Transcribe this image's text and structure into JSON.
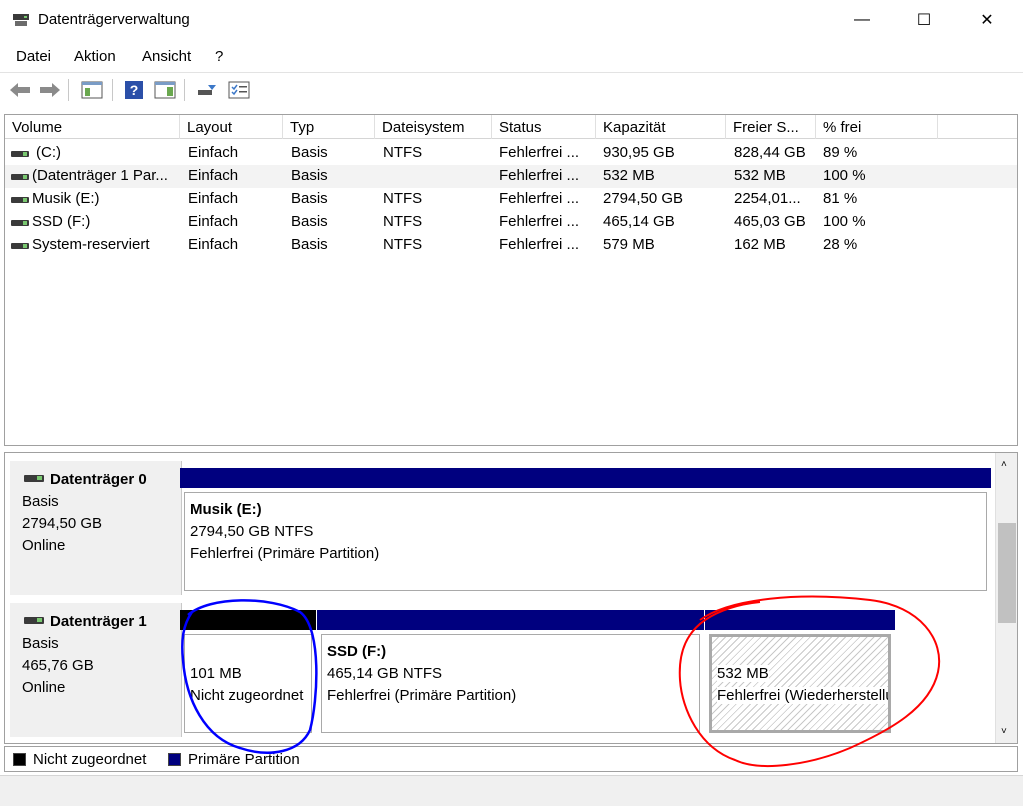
{
  "window": {
    "title": "Datenträgerverwaltung",
    "controls": {
      "minimize": "—",
      "maximize": "☐",
      "close": "✕"
    }
  },
  "menu": [
    "Datei",
    "Aktion",
    "Ansicht",
    "?"
  ],
  "toolbar": {
    "icons": [
      "back-arrow-icon",
      "forward-arrow-icon",
      "console-tree-icon",
      "help-icon",
      "action-pane-icon",
      "connect-icon",
      "properties-icon"
    ]
  },
  "volume_list": {
    "columns": [
      "Volume",
      "Layout",
      "Typ",
      "Dateisystem",
      "Status",
      "Kapazität",
      "Freier S...",
      "% frei"
    ],
    "rows": [
      {
        "volume": "(C:)",
        "layout": "Einfach",
        "typ": "Basis",
        "dateisystem": "NTFS",
        "status": "Fehlerfrei ...",
        "kapazitaet": "930,95 GB",
        "frei": "828,44 GB",
        "prozent": "89 %"
      },
      {
        "volume": "(Datenträger 1 Par...",
        "layout": "Einfach",
        "typ": "Basis",
        "dateisystem": "",
        "status": "Fehlerfrei ...",
        "kapazitaet": "532 MB",
        "frei": "532 MB",
        "prozent": "100 %"
      },
      {
        "volume": "Musik (E:)",
        "layout": "Einfach",
        "typ": "Basis",
        "dateisystem": "NTFS",
        "status": "Fehlerfrei ...",
        "kapazitaet": "2794,50 GB",
        "frei": "2254,01...",
        "prozent": "81 %"
      },
      {
        "volume": "SSD (F:)",
        "layout": "Einfach",
        "typ": "Basis",
        "dateisystem": "NTFS",
        "status": "Fehlerfrei ...",
        "kapazitaet": "465,14 GB",
        "frei": "465,03 GB",
        "prozent": "100 %"
      },
      {
        "volume": "System-reserviert",
        "layout": "Einfach",
        "typ": "Basis",
        "dateisystem": "NTFS",
        "status": "Fehlerfrei ...",
        "kapazitaet": "579 MB",
        "frei": "162 MB",
        "prozent": "28 %"
      }
    ]
  },
  "disks": [
    {
      "name": "Datenträger 0",
      "type": "Basis",
      "size": "2794,50 GB",
      "state": "Online",
      "partitions": [
        {
          "title": "Musik  (E:)",
          "line1": "2794,50 GB NTFS",
          "line2": "Fehlerfrei (Primäre Partition)",
          "bar_color": "#00007f"
        }
      ]
    },
    {
      "name": "Datenträger 1",
      "type": "Basis",
      "size": "465,76 GB",
      "state": "Online",
      "partitions": [
        {
          "title": "",
          "line1": "101 MB",
          "line2": "Nicht zugeordnet",
          "bar_color": "#000000"
        },
        {
          "title": "SSD  (F:)",
          "line1": "465,14 GB NTFS",
          "line2": "Fehlerfrei (Primäre Partition)",
          "bar_color": "#00007f"
        },
        {
          "title": "",
          "line1": "532 MB",
          "line2": "Fehlerfrei (Wiederherstellungspartition)",
          "bar_color": "#00007f"
        }
      ]
    }
  ],
  "legend": [
    {
      "label": "Nicht zugeordnet",
      "color": "#000000"
    },
    {
      "label": "Primäre Partition",
      "color": "#00007f"
    }
  ],
  "annotations": {
    "blue_circle_color": "#0000ff",
    "red_circle_color": "#ff0000"
  }
}
